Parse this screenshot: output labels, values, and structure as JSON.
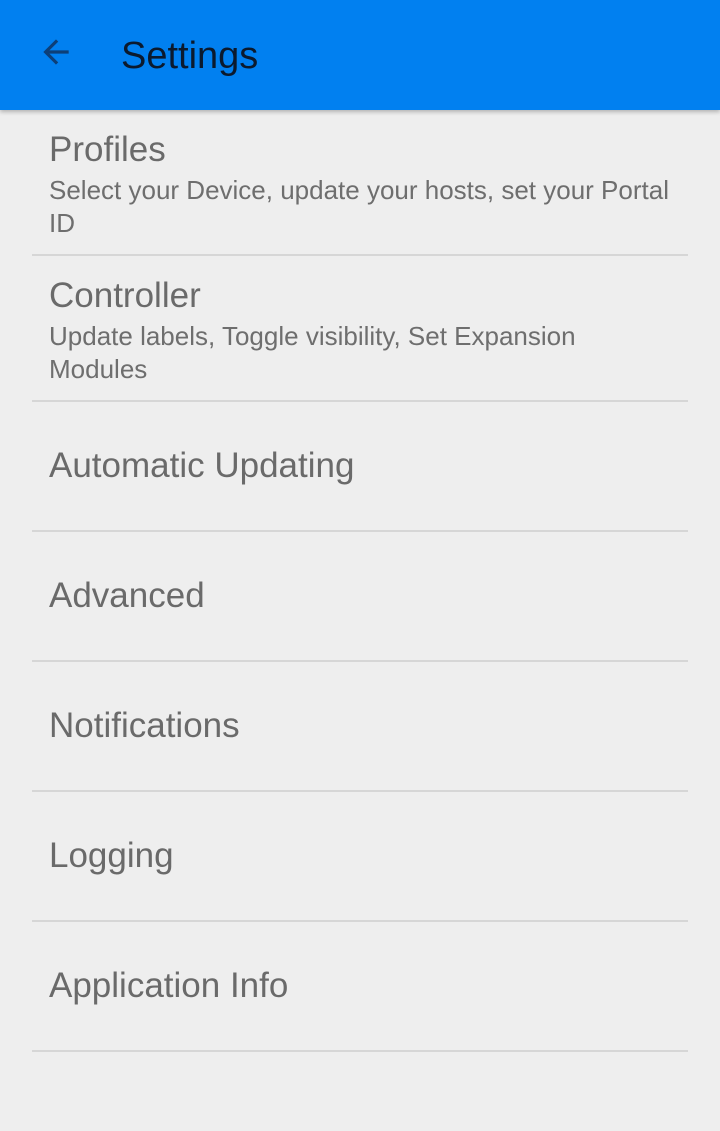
{
  "app_bar": {
    "title": "Settings",
    "back_icon": "arrow-back-icon",
    "background_color": "#0180f0"
  },
  "settings": {
    "items": [
      {
        "title": "Profiles",
        "summary": "Select your Device, update your hosts, set your Portal ID"
      },
      {
        "title": "Controller",
        "summary": "Update labels, Toggle visibility, Set Expansion Modules"
      },
      {
        "title": "Automatic Updating"
      },
      {
        "title": "Advanced"
      },
      {
        "title": "Notifications"
      },
      {
        "title": "Logging"
      },
      {
        "title": "Application Info"
      }
    ]
  }
}
